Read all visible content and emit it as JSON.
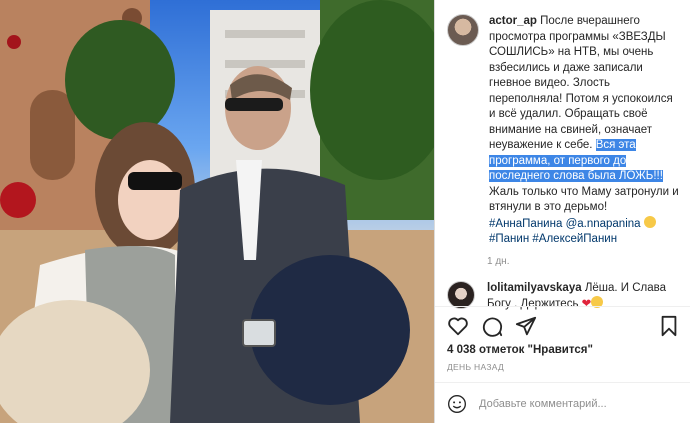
{
  "photo": {
    "alt_icon": "post-photo"
  },
  "caption": {
    "username": "actor_ap",
    "text_part1": "После вчерашнего просмотра программы «ЗВЕЗДЫ СОШЛИСЬ» на НТВ, мы очень взбесились и даже записали гневное видео. Злость переполняла! Потом я успокоился и всё удалил. Обращать своё внимание на свиней, означает неуважение к себе.",
    "highlight": "Вся эта программа, от первого до последнего слова была ЛОЖЬ!!!",
    "text_part2": "Жаль только что Маму затронули и втянули в это дерьмо!",
    "tag1": "#АннаПанина",
    "mention": "@a.nnapanina",
    "tag2": "#Панин",
    "tag3": "#АлексейПанин",
    "time": "1 дн."
  },
  "comment": {
    "username": "lolitamilyavskaya",
    "text": "Лёша. И Слава Богу . Держитесь"
  },
  "likes": "4 038 отметок \"Нравится\"",
  "date": "ДЕНЬ НАЗАД",
  "add_comment": {
    "placeholder": "Добавьте комментарий..."
  }
}
